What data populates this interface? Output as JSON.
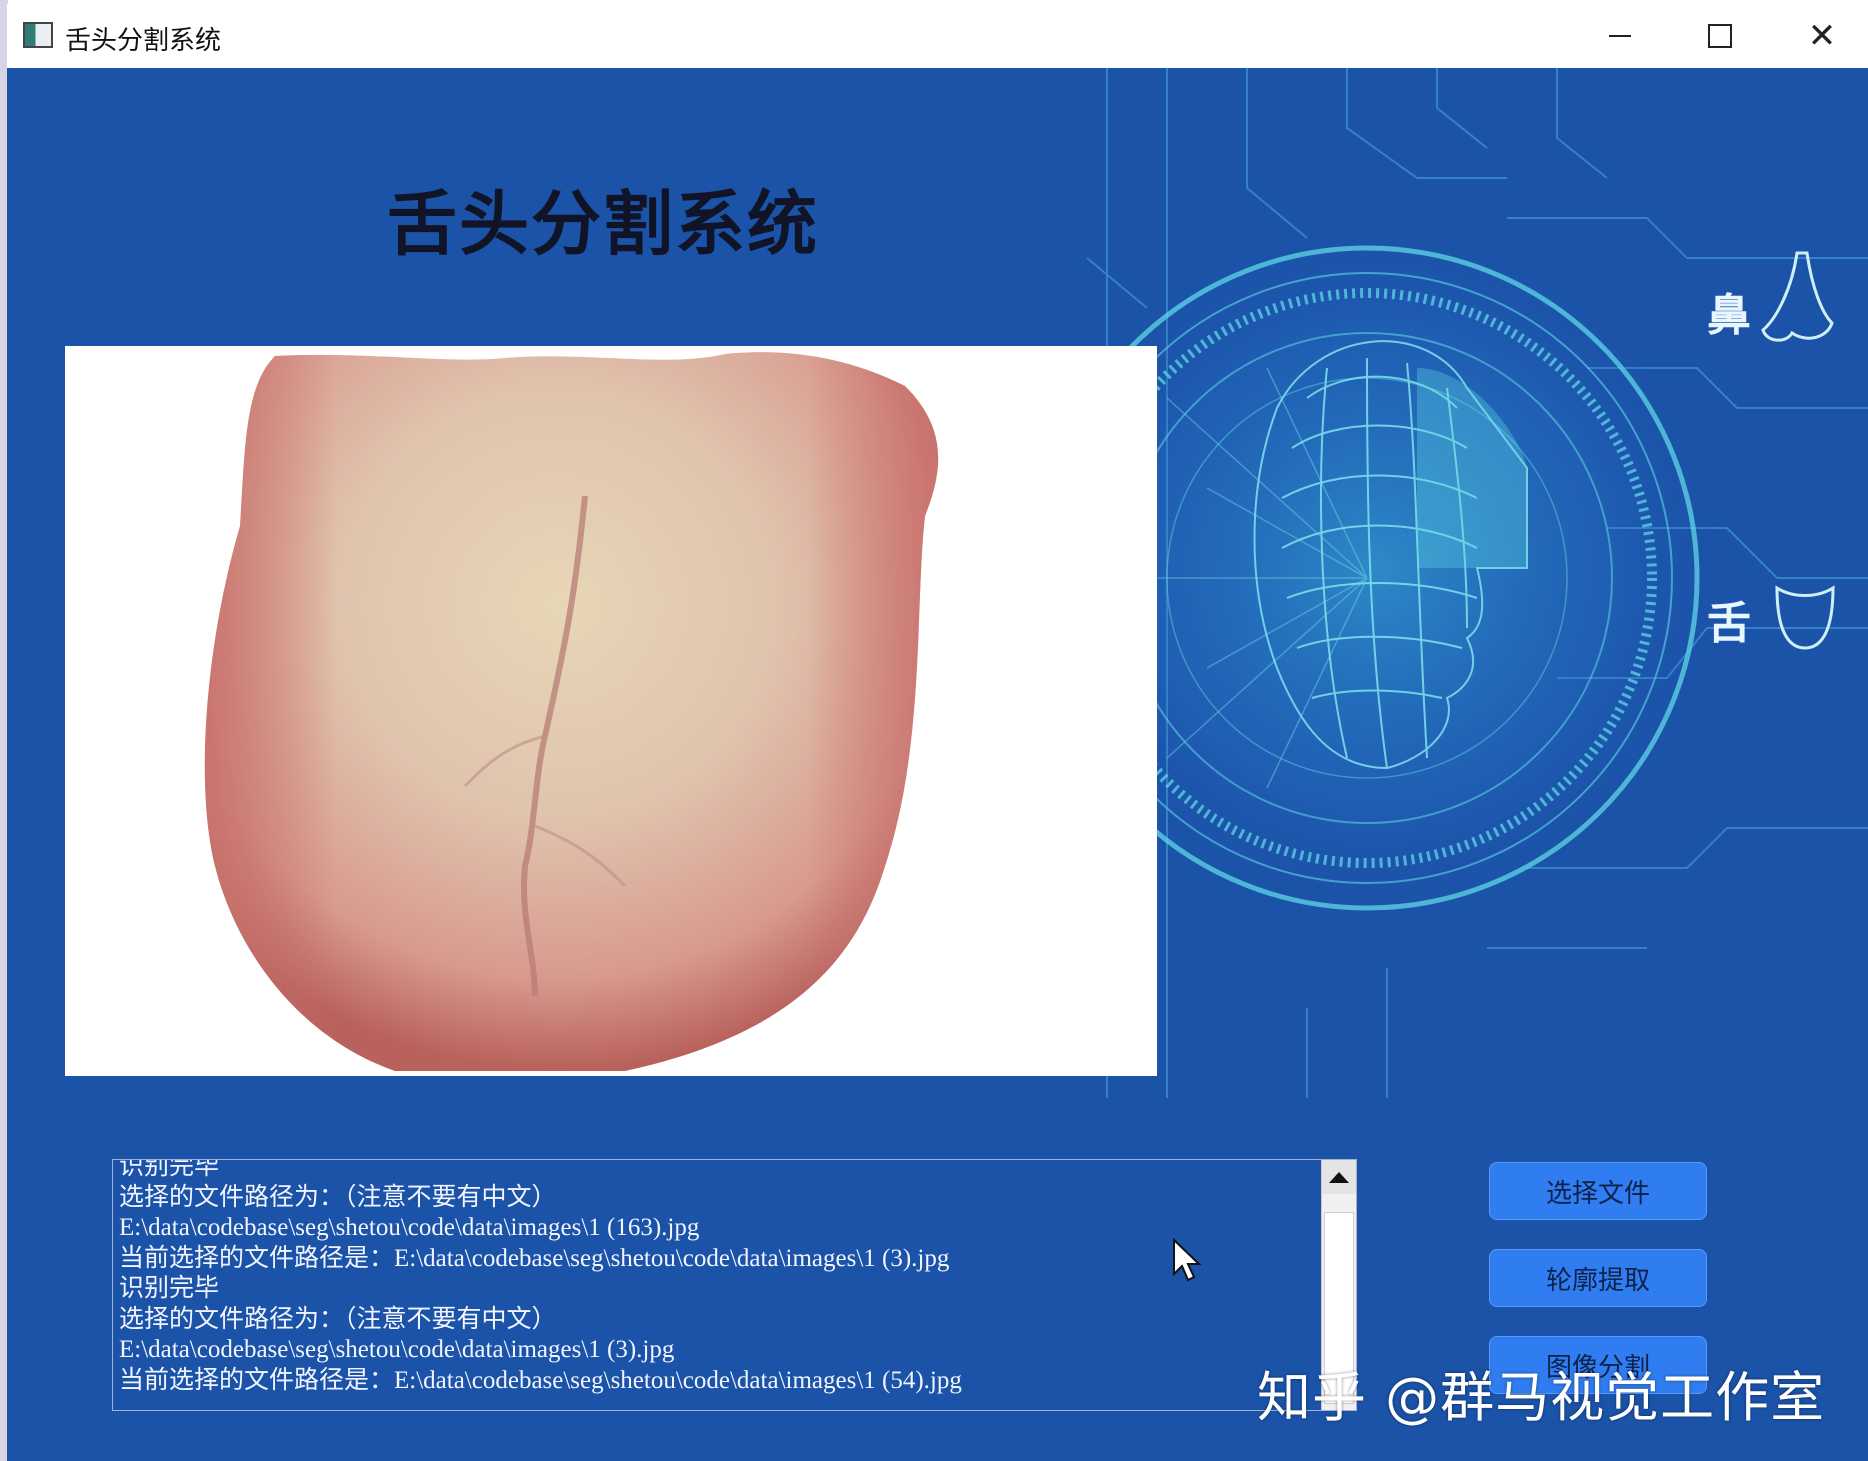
{
  "window": {
    "title": "舌头分割系统"
  },
  "main": {
    "title": "舌头分割系统",
    "side_labels": [
      "鼻",
      "舌"
    ]
  },
  "log": {
    "lines": [
      "识别完毕",
      "选择的文件路径为：（注意不要有中文）",
      "E:\\data\\codebase\\seg\\shetou\\code\\data\\images\\1 (163).jpg",
      "当前选择的文件路径是：E:\\data\\codebase\\seg\\shetou\\code\\data\\images\\1 (3).jpg",
      "识别完毕",
      "选择的文件路径为：（注意不要有中文）",
      "E:\\data\\codebase\\seg\\shetou\\code\\data\\images\\1 (3).jpg",
      "当前选择的文件路径是：E:\\data\\codebase\\seg\\shetou\\code\\data\\images\\1 (54).jpg"
    ]
  },
  "buttons": {
    "select_file": "选择文件",
    "contour_extract": "轮廓提取",
    "image_segment": "图像分割"
  },
  "watermark": "知乎 @群马视觉工作室",
  "colors": {
    "background": "#1b53a9",
    "button": "#2f7df0",
    "accent_cyan": "#5fd6e6"
  }
}
